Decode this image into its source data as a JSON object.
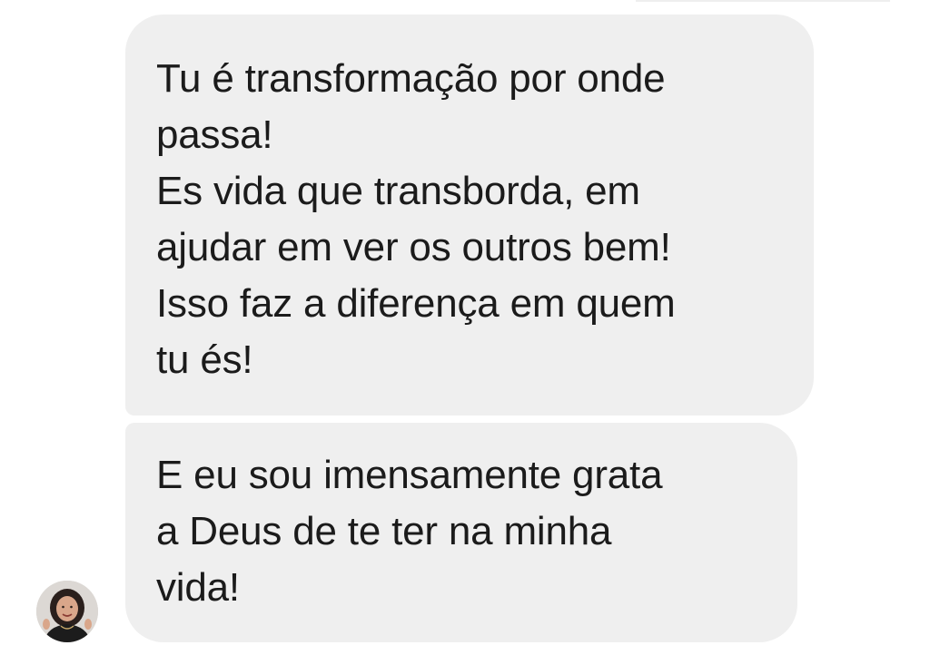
{
  "conversation": {
    "messages": [
      {
        "text": "Tu é transformação por onde\npassa!\nEs vida que transborda, em\najudar em ver os outros bem!\nIsso faz a diferença em quem\ntu és!"
      },
      {
        "text": "E eu sou imensamente grata\na Deus de te ter na minha\nvida!"
      }
    ]
  }
}
